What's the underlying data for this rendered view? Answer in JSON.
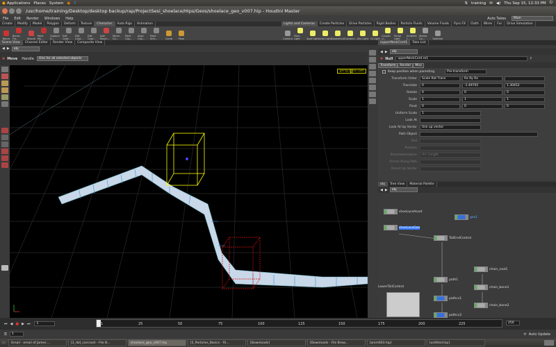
{
  "gnome_panel": {
    "applications": "Applications",
    "places": "Places",
    "system": "System",
    "user": "training",
    "clock": "Thu Sep 15, 12:33 PM"
  },
  "window": {
    "title": "/usr/home/training/Desktop/desktop backup/rap/ProjectSesi_shoelace/Hips/Geos/shoelace_geo_v007.hip - Houdini Master"
  },
  "menu": [
    "File",
    "Edit",
    "Render",
    "Windows",
    "Help"
  ],
  "desktop_selector": {
    "label": "Main",
    "auto_takes": "Auto Takes"
  },
  "shelf_left": {
    "tabs": [
      "Create",
      "Modify",
      "Model",
      "Polygon",
      "Deform",
      "Texture",
      "Character",
      "Auto Rigs",
      "Animation"
    ],
    "active_tab": "Character",
    "tools": [
      {
        "label": "Bones",
        "color": "#c33"
      },
      {
        "label": "Bones Fro...",
        "color": "#c33"
      },
      {
        "label": "Muscle",
        "color": "#c44"
      },
      {
        "label": "Paint Mu...",
        "color": "#b33"
      },
      {
        "label": "Capture G...",
        "color": "#888"
      },
      {
        "label": "Edit Capt...",
        "color": "#888"
      },
      {
        "label": "Edit Capt...",
        "color": "#888"
      },
      {
        "label": "Edit Capt...",
        "color": "#888"
      },
      {
        "label": "Add Muscl...",
        "color": "#c44"
      },
      {
        "label": "Mirror Ca...",
        "color": "#888"
      },
      {
        "label": "Paint Cap...",
        "color": "#888"
      },
      {
        "label": "Align Cap...",
        "color": "#888"
      },
      {
        "label": "Paint Shd...",
        "color": "#888"
      },
      {
        "label": "Comb",
        "color": "#c93"
      },
      {
        "label": "Pose",
        "color": "#c93"
      }
    ]
  },
  "shelf_right": {
    "tabs": [
      "Lights and Cameras",
      "Create Particles",
      "Drive Particles",
      "Rigid Bodies",
      "Particle Fluids",
      "Volume Fluids",
      "Pyro FX",
      "Cloth",
      "Wires",
      "Fur",
      "Drive Simulation"
    ],
    "active_tab": "Lights and Cameras",
    "tools": [
      {
        "label": "Camera",
        "color": "#999"
      },
      {
        "label": "Point Light",
        "color": "#ee6"
      },
      {
        "label": "Spot Light",
        "color": "#ee6"
      },
      {
        "label": "Area Light",
        "color": "#ee6"
      },
      {
        "label": "Geometry...",
        "color": "#ee6"
      },
      {
        "label": "Environm...",
        "color": "#ee6"
      },
      {
        "label": "Sky Light",
        "color": "#ee6"
      },
      {
        "label": "GI Light",
        "color": "#ee6"
      },
      {
        "label": "Caustic Li...",
        "color": "#ee6"
      },
      {
        "label": "Portal Light",
        "color": "#ee6"
      },
      {
        "label": "Ambient L...",
        "color": "#ee6"
      },
      {
        "label": "Stereo Ca...",
        "color": "#999"
      },
      {
        "label": "Switcher",
        "color": "#999"
      }
    ]
  },
  "left_tabs": [
    "Scene View",
    "Channel Editor",
    "Render View",
    "Composite View"
  ],
  "viewport": {
    "path": "obj",
    "mode": "Move",
    "handle_label": "Handle",
    "handle_value": "One for all selected objects",
    "persp": "persp1",
    "cam": "no cam"
  },
  "param_tabs_top": [
    "/upperNeckCont1",
    "Take List"
  ],
  "params": {
    "path": "obj",
    "node_type": "Null",
    "node_name": "upperNeckCont.ro1",
    "tabs": [
      "Transform",
      "Render",
      "Misc"
    ],
    "keep_position": "Keep position when parenting",
    "keep_value": "Pre-transform",
    "rows": [
      {
        "label": "Transform Order",
        "v1": "Scale Rot Trans",
        "v2": "Rx Ry Rz",
        "v3": ""
      },
      {
        "label": "Translate",
        "v1": "0",
        "v2": "-1.49705",
        "v3": "1.30452"
      },
      {
        "label": "Rotate",
        "v1": "0",
        "v2": "0",
        "v3": "0"
      },
      {
        "label": "Scale",
        "v1": "1",
        "v2": "1",
        "v3": "1"
      },
      {
        "label": "Pivot",
        "v1": "0",
        "v2": "0",
        "v3": "0"
      },
      {
        "label": "Uniform Scale",
        "v1": "1",
        "v2": "",
        "v3": ""
      },
      {
        "label": "Look At",
        "v1": "",
        "v2": "",
        "v3": ""
      },
      {
        "label": "Look At Up Vector",
        "v1": "Use up vector",
        "v2": "",
        "v3": ""
      },
      {
        "label": "Path Object",
        "v1": "",
        "v2": "",
        "v3": ""
      },
      {
        "label": "Roll",
        "v1": "",
        "v2": "",
        "v3": ""
      },
      {
        "label": "Position",
        "v1": "",
        "v2": "",
        "v3": ""
      },
      {
        "label": "Parameterization",
        "v1": "Arc Length",
        "v2": "",
        "v3": ""
      },
      {
        "label": "Orient Along Path",
        "v1": "",
        "v2": "",
        "v3": ""
      },
      {
        "label": "Orient Up Vector",
        "v1": "",
        "v2": "",
        "v3": ""
      }
    ]
  },
  "net_tabs": [
    "obj",
    "Tree View",
    "Material Palette"
  ],
  "network": {
    "path": "obj",
    "nodes": [
      {
        "name": "shoeLaceAsset",
        "blue": false
      },
      {
        "name": "shoeLaceGeo",
        "blue": false
      },
      {
        "name": "geo1",
        "blue": true
      },
      {
        "name": "TailEndControl",
        "blue": false
      },
      {
        "name": "chain_root1",
        "blue": false
      },
      {
        "name": "path1",
        "blue": false
      },
      {
        "name": "chain_bone1",
        "blue": false
      },
      {
        "name": "pathcv1",
        "blue": true
      },
      {
        "name": "chain_bone2",
        "blue": false
      },
      {
        "name": "pathcv2",
        "blue": true
      },
      {
        "name": "LowerTailControl",
        "blue": false
      }
    ]
  },
  "timeline": {
    "ticks": [
      "1",
      "25",
      "50",
      "75",
      "100",
      "125",
      "150",
      "175",
      "200",
      "225"
    ],
    "current_frame": "1",
    "start": "1",
    "end": "250",
    "auto_update": "Auto Update"
  },
  "taskbar": [
    {
      "label": "Gmail - email of James ...",
      "active": false
    },
    {
      "label": "[3_rbd_carcrash - File B...",
      "active": false
    },
    {
      "label": "shoelace_geo_v007.hip",
      "active": true
    },
    {
      "label": "[5_Particles_Basics - Fil...",
      "active": false
    },
    {
      "label": "[Downloads]",
      "active": false
    },
    {
      "label": "[Downloads - File Brow...",
      "active": false
    },
    {
      "label": "[anim003.hip]",
      "active": false
    },
    {
      "label": "[untitled.hip]",
      "active": false
    }
  ]
}
